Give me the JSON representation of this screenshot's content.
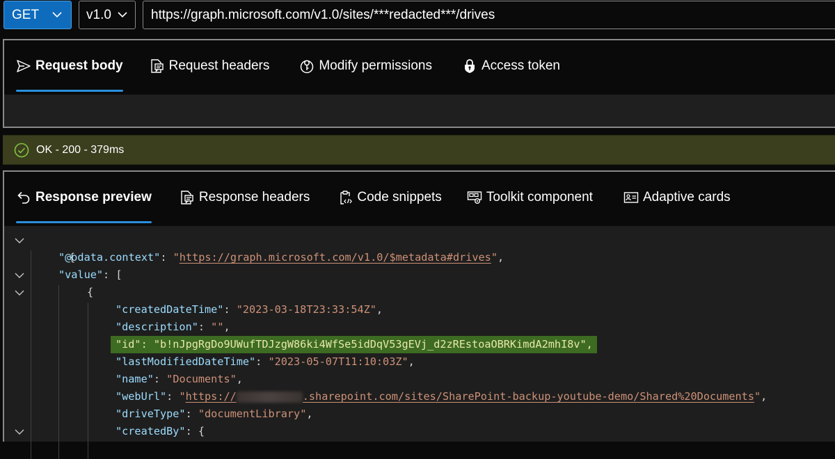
{
  "request": {
    "method": "GET",
    "version": "v1.0",
    "url": "https://graph.microsoft.com/v1.0/sites/***redacted***/drives"
  },
  "request_tabs": [
    {
      "label": "Request body",
      "icon": "send-icon",
      "active": true
    },
    {
      "label": "Request headers",
      "icon": "document-comment-icon",
      "active": false
    },
    {
      "label": "Modify permissions",
      "icon": "permissions-key-icon",
      "active": false
    },
    {
      "label": "Access token",
      "icon": "lock-shield-icon",
      "active": false
    }
  ],
  "status": {
    "text": "OK - 200 - 379ms",
    "icon": "check-circle-icon",
    "color": "#84c341"
  },
  "response_tabs": [
    {
      "label": "Response preview",
      "icon": "arrow-undo-icon",
      "active": true
    },
    {
      "label": "Response headers",
      "icon": "document-comment-icon",
      "active": false
    },
    {
      "label": "Code snippets",
      "icon": "clipboard-code-icon",
      "active": false
    },
    {
      "label": "Toolkit component",
      "icon": "toolkit-gear-icon",
      "active": false
    },
    {
      "label": "Adaptive cards",
      "icon": "contact-card-icon",
      "active": false
    }
  ],
  "response_json": {
    "open_brace": "{",
    "odata_context_key": "\"@odata.context\"",
    "odata_context_value": "https://graph.microsoft.com/v1.0/$metadata#drives",
    "value_key": "\"value\"",
    "open_bracket": "[",
    "item_open": "{",
    "createdDateTime_key": "\"createdDateTime\"",
    "createdDateTime_value": "\"2023-03-18T23:33:54Z\"",
    "description_key": "\"description\"",
    "description_value": "\"\"",
    "id_key": "\"id\"",
    "id_value": "\"b!nJpgRgDo9UWufTDJzgW86ki4WfSe5idDqV53gEVj_d2zREstoaOBRKimdA2mhI8v\"",
    "lastModifiedDateTime_key": "\"lastModifiedDateTime\"",
    "lastModifiedDateTime_value": "\"2023-05-07T11:10:03Z\"",
    "name_key": "\"name\"",
    "name_value": "\"Documents\"",
    "webUrl_key": "\"webUrl\"",
    "webUrl_prefix": "https://",
    "webUrl_suffix": ".sharepoint.com/sites/SharePoint-backup-youtube-demo/Shared%20Documents",
    "driveType_key": "\"driveType\"",
    "driveType_value": "\"documentLibrary\"",
    "createdBy_key": "\"createdBy\"",
    "colon": ": ",
    "comma": ",",
    "quote": "\""
  },
  "colors": {
    "accent": "#0f6cbd",
    "tab_underline": "#2a8fde",
    "status_bg": "#3b3f1e",
    "highlight_bg": "#3d6b22",
    "json_key": "#9cdcfe",
    "json_string": "#ce9178"
  }
}
